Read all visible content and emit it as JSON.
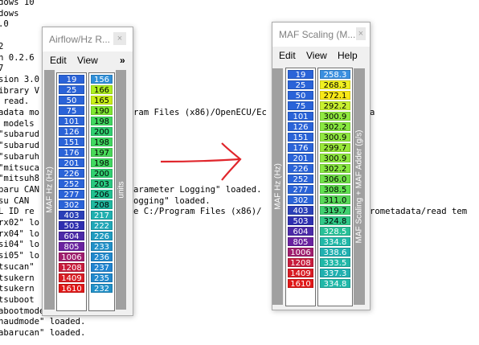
{
  "console": {
    "lines": [
      "dows 10",
      "dows",
      ".0",
      "",
      "2",
      "n 0.2.6",
      "7",
      "sion 3.0",
      "ibrary V",
      " read.",
      "adata mo",
      " models",
      "\"subarud",
      "\"subarud",
      "\"subaruh",
      "\"mitsuca",
      "\"mitsuh8",
      "baru CAN",
      "su CAN",
      "L ID re",
      "rx02\" lo",
      "rx04\" lo",
      "si04\" lo",
      "si05\" lo",
      "tsucan\"",
      "tsukern",
      "tsukern",
      "tsuboot",
      "abootmode\" loaded.",
      "haudmode\" loaded.",
      "abarucan\" loaded."
    ],
    "fragments": [
      {
        "text": "ram Files (x86)/OpenECU/Ec",
        "line": 10
      },
      {
        "text": "arameter Logging\" loaded.",
        "line": 17
      },
      {
        "text": "ogging\" loaded.",
        "line": 18
      },
      {
        "text": "e C:/Program Files (x86)/",
        "line": 19
      }
    ],
    "right_fragments": [
      {
        "text": "a",
        "line": 10
      },
      {
        "text": "rometadata/read tem",
        "line": 19
      }
    ]
  },
  "window1": {
    "title": "Airflow/Hz R...",
    "close_label": "×",
    "menu": {
      "edit": "Edit",
      "view": "View",
      "more": "»"
    },
    "y_axis_label": "MAF Hz (Hz)",
    "z_axis_label": "units",
    "x_values": [
      "19",
      "25",
      "50",
      "75",
      "101",
      "126",
      "151",
      "176",
      "201",
      "226",
      "252",
      "277",
      "302",
      "403",
      "503",
      "604",
      "805",
      "1006",
      "1208",
      "1409",
      "1610"
    ],
    "z_values": [
      "156",
      "166",
      "165",
      "190",
      "198",
      "200",
      "198",
      "197",
      "198",
      "200",
      "203",
      "206",
      "208",
      "217",
      "222",
      "226",
      "233",
      "236",
      "237",
      "235",
      "232"
    ]
  },
  "window2": {
    "title": "MAF Scaling (M...",
    "close_label": "×",
    "menu": {
      "edit": "Edit",
      "view": "View",
      "help": "Help"
    },
    "y_axis_label": "MAF Hz (Hz)",
    "z_axis_label": "MAF Scaling + MAF Adder (g/s)",
    "x_values": [
      "19",
      "25",
      "50",
      "75",
      "101",
      "126",
      "151",
      "176",
      "201",
      "226",
      "252",
      "277",
      "302",
      "403",
      "503",
      "604",
      "805",
      "1006",
      "1208",
      "1409",
      "1610"
    ],
    "z_values": [
      "258.3",
      "268.3",
      "272.1",
      "292.2",
      "300.9",
      "302.2",
      "300.9",
      "299.7",
      "300.9",
      "302.2",
      "306.0",
      "308.5",
      "311.0",
      "319.7",
      "324.8",
      "328.5",
      "334.8",
      "338.6",
      "333.5",
      "337.3",
      "334.8"
    ]
  },
  "colors": {
    "x_axis_cells": [
      "#2a63d8",
      "#2a63d8",
      "#2a63d8",
      "#2a63d8",
      "#2a63d8",
      "#2a63d8",
      "#2a63d8",
      "#2a63d8",
      "#2a63d8",
      "#2a63d8",
      "#2a63d8",
      "#2a63d8",
      "#2a63d8",
      "#2a3fb8",
      "#2e2eb0",
      "#4b2aa8",
      "#6a22a0",
      "#a01e6e",
      "#c81c3c",
      "#d81c24",
      "#e01818"
    ],
    "w1_z_cells": [
      "#2f8fd8",
      "#aef020",
      "#c8f018",
      "#7fe830",
      "#40d860",
      "#30d070",
      "#40d860",
      "#48d858",
      "#40d860",
      "#30d070",
      "#28c880",
      "#20c090",
      "#20b8a0",
      "#20b0b0",
      "#20a8b8",
      "#209cc0",
      "#2090c8",
      "#2088cc",
      "#2084d0",
      "#2088cc",
      "#2090c8"
    ],
    "w2_z_cells": [
      "#3a8fe0",
      "#f0f020",
      "#f8e818",
      "#c8f030",
      "#90e840",
      "#88e840",
      "#90e840",
      "#98e838",
      "#90e840",
      "#88e840",
      "#70e048",
      "#60e050",
      "#58d858",
      "#40d070",
      "#30c888",
      "#28c098",
      "#20b8a8",
      "#20b0b0",
      "#20b8a8",
      "#20b0b0",
      "#20b8a8"
    ],
    "arrow": "#e0262c"
  }
}
